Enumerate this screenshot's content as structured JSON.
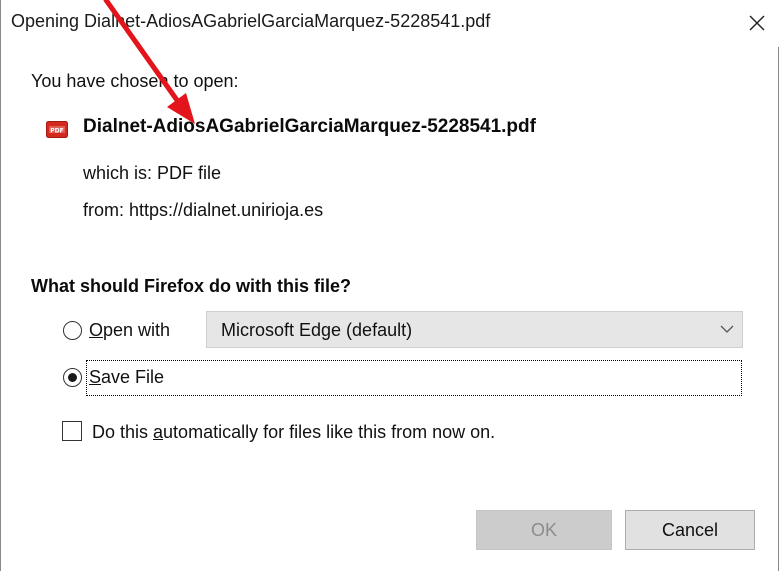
{
  "window": {
    "title": "Opening Dialnet-AdiosAGabrielGarciaMarquez-5228541.pdf"
  },
  "file": {
    "intro": "You have chosen to open:",
    "name": "Dialnet-AdiosAGabrielGarciaMarquez-5228541.pdf",
    "type_label": "which is:",
    "type_value": "PDF file",
    "from_label": "from:",
    "from_value": "https://dialnet.unirioja.es",
    "icon": "pdf-file-icon"
  },
  "action": {
    "question": "What should Firefox do with this file?",
    "open_with": {
      "accel": "O",
      "rest": "pen with",
      "selected": false,
      "app": "Microsoft Edge (default)"
    },
    "save_file": {
      "accel": "S",
      "rest": "ave File",
      "selected": true
    },
    "auto": {
      "pre": "Do this ",
      "accel": "a",
      "rest": "utomatically for files like this from now on.",
      "checked": false
    }
  },
  "buttons": {
    "ok": "OK",
    "cancel": "Cancel",
    "ok_enabled": false
  },
  "annotation": {
    "arrow_color": "#e3141b"
  },
  "colors": {
    "pdf_red": "#d42a1e",
    "ok_disabled_bg": "#cccccc",
    "cancel_bg": "#e1e1e1"
  }
}
